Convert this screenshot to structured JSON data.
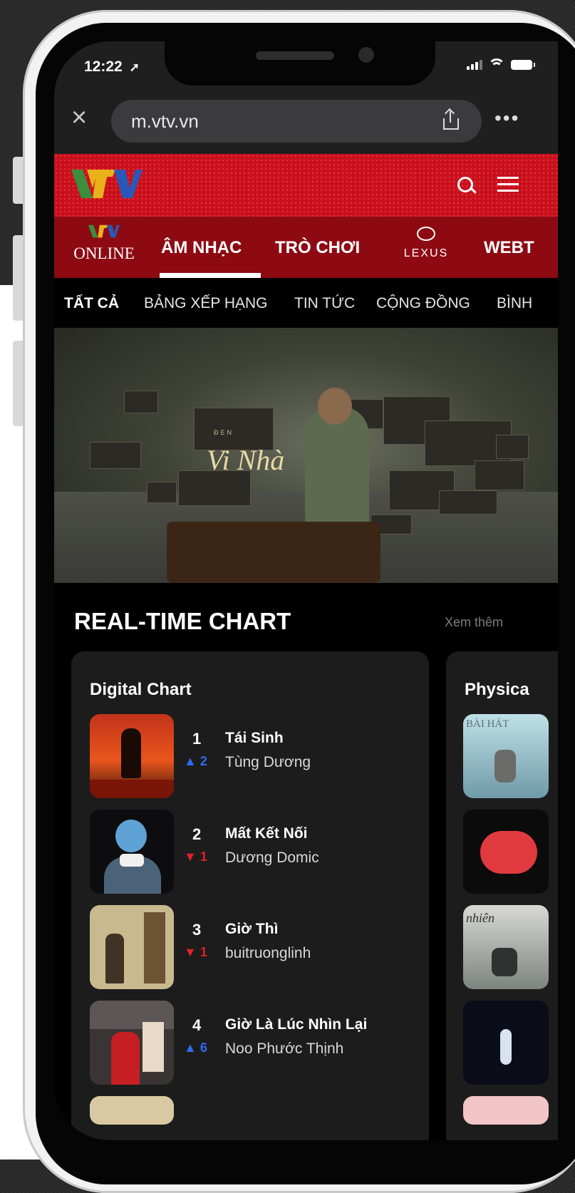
{
  "status": {
    "time": "12:22",
    "location_icon": "location-arrow-icon",
    "icons": [
      "signal-icon",
      "wifi-icon",
      "battery-icon"
    ]
  },
  "browser": {
    "url": "m.vtv.vn",
    "close_icon": "close-icon",
    "share_icon": "share-icon",
    "more_icon": "more-icon"
  },
  "header": {
    "logo": "VTV",
    "search_icon": "search-icon",
    "menu_icon": "menu-icon",
    "brand_color": "#c8101b"
  },
  "nav": {
    "online_logo": "VTV",
    "online_label": "ONLINE",
    "items": [
      "ÂM NHẠC",
      "TRÒ CHƠI",
      "WEBT"
    ],
    "sponsor_label": "LEXUS",
    "active_index": 0
  },
  "subnav": {
    "items": [
      "TẤT CẢ",
      "BẢNG XẾP HẠNG",
      "TIN TỨC",
      "CỘNG ĐỒNG",
      "BÌNH"
    ],
    "active_index": 0
  },
  "hero": {
    "title": "Vi Nhà",
    "small_text": "ĐEN"
  },
  "chart_section": {
    "title": "REAL-TIME CHART",
    "see_more": "Xem thêm",
    "digital": {
      "title": "Digital Chart",
      "items": [
        {
          "rank": "1",
          "direction": "up",
          "change": "2",
          "song": "Tái Sinh",
          "artist": "Tùng Dương"
        },
        {
          "rank": "2",
          "direction": "down",
          "change": "1",
          "song": "Mất Kết Nối",
          "artist": "Dương Domic"
        },
        {
          "rank": "3",
          "direction": "down",
          "change": "1",
          "song": "Giờ Thì",
          "artist": "buitruonglinh"
        },
        {
          "rank": "4",
          "direction": "up",
          "change": "6",
          "song": "Giờ Là Lúc Nhìn Lại",
          "artist": "Noo Phước Thịnh"
        }
      ]
    },
    "physical": {
      "title": "Physica",
      "cover_texts": [
        "BÀI HÁT",
        "nhiên"
      ]
    },
    "colors": {
      "up": "#2f6cf0",
      "down": "#e0202a"
    }
  }
}
